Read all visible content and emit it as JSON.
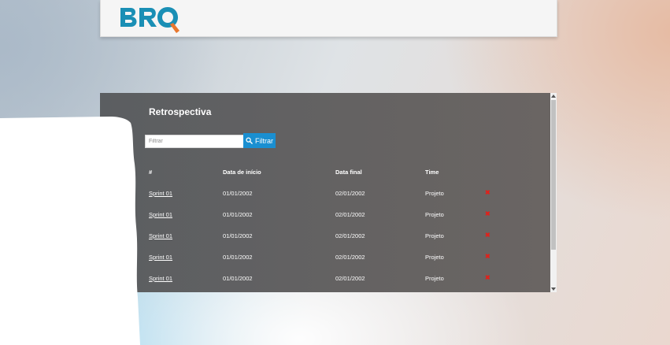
{
  "header": {
    "logo_text": "BRQ",
    "colors": {
      "logo_primary": "#1a8fb5",
      "logo_accent": "#e8772e"
    }
  },
  "panel": {
    "title": "Retrospectiva",
    "filter": {
      "placeholder": "Filtrar",
      "value": "",
      "button_label": "Filtrar",
      "button_icon": "search-icon"
    },
    "table": {
      "columns": [
        "#",
        "Data de início",
        "Data final",
        "Time"
      ],
      "rows": [
        {
          "name": "Sprint 01",
          "start": "01/01/2002",
          "end": "02/01/2002",
          "team": "Projeto"
        },
        {
          "name": "Sprint 01",
          "start": "01/01/2002",
          "end": "02/01/2002",
          "team": "Projeto"
        },
        {
          "name": "Sprint 01",
          "start": "01/01/2002",
          "end": "02/01/2002",
          "team": "Projeto"
        },
        {
          "name": "Sprint 01",
          "start": "01/01/2002",
          "end": "02/01/2002",
          "team": "Projeto"
        },
        {
          "name": "Sprint 01",
          "start": "01/01/2002",
          "end": "02/01/2002",
          "team": "Projeto"
        }
      ],
      "delete_icon": "close-icon",
      "colors": {
        "delete": "#e0211b"
      }
    }
  },
  "colors": {
    "accent": "#1a8fd1",
    "panel_bg": "#606162"
  }
}
